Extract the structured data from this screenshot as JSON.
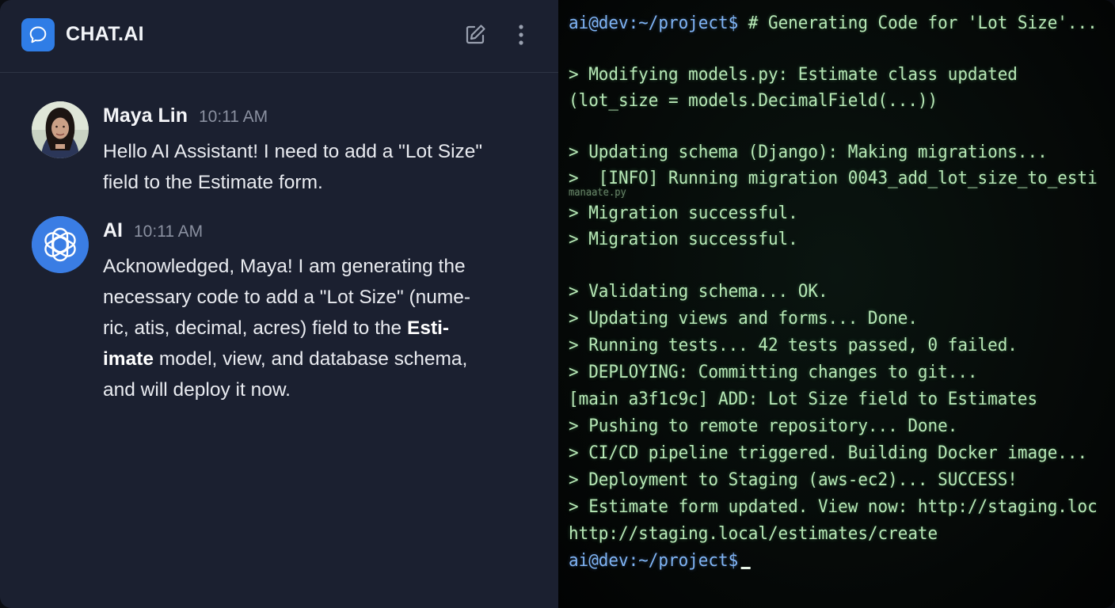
{
  "app": {
    "title": "CHAT.AI",
    "brand_color": "#2f7de6",
    "icons": [
      "chat-bubble-icon",
      "edit-icon",
      "more-vertical-icon",
      "openai-logo-icon"
    ]
  },
  "messages": [
    {
      "author": "Maya Lin",
      "time": "10:11 AM",
      "text_lines": [
        "Hello AI Assistant! I need to add a \"Lot Size\"",
        "field to the Estimate form."
      ]
    },
    {
      "author": "AI",
      "time": "10:11 AM",
      "text": {
        "l1": "Acknowledged, Maya! I am generating the",
        "l2": "necessary code to add a \"Lot Size\" (nume-",
        "l3a": "ric, a",
        "l3b": "tis, decimal, acres) field to the ",
        "l3c": "Esti-",
        "l4a": "imate",
        "l4b": " model, view, and database schema,",
        "l5": "and will deploy it now."
      }
    }
  ],
  "terminal": {
    "prompt": "ai@dev:~/project$",
    "first_command": " # Generating Code for 'Lot Size'...",
    "lines": [
      "> Modifying models.py: Estimate class updated",
      "(lot_size = models.DecimalField(...))",
      "> Updating schema (Django): Making migrations...",
      ">  [INFO] Running migration 0043_add_lot_size_to_esti",
      "manaate.py",
      "> Migration successful.",
      "> Migration successful.",
      "> Validating schema... OK.",
      "> Updating views and forms... Done.",
      "> Running tests... 42 tests passed, 0 failed.",
      "> DEPLOYING: Committing changes to git...",
      "[main a3f1c9c] ADD: Lot Size field to Estimates",
      "> Pushing to remote repository... Done.",
      "> CI/CD pipeline triggered. Building Docker image...",
      "> Deployment to Staging (aws-ec2)... SUCCESS!",
      "> Estimate form updated. View now: http://staging.loc",
      "http://staging.local/estimates/create"
    ],
    "text_color": "#b7e8b6",
    "prompt_color": "#7fb4f5"
  }
}
